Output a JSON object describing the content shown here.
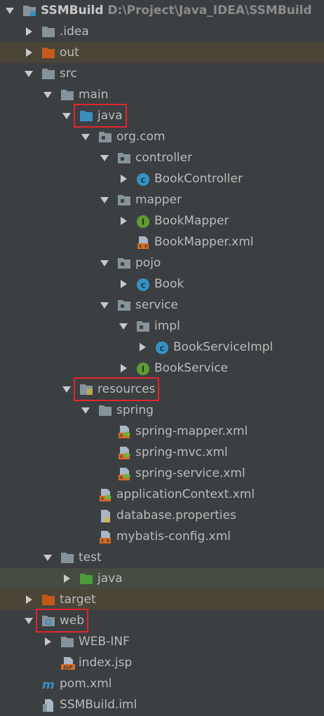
{
  "tree": [
    {
      "label": "SSMBuild",
      "path": "D:\\Project\\Java_IDEA\\SSMBuild",
      "icon": "module-folder-icon",
      "depth": 0,
      "arrow": "down"
    },
    {
      "label": ".idea",
      "icon": "folder-icon",
      "depth": 1,
      "arrow": "right"
    },
    {
      "label": "out",
      "icon": "excluded-folder-icon",
      "depth": 1,
      "arrow": "right",
      "highlight": "brown"
    },
    {
      "label": "src",
      "icon": "folder-icon",
      "depth": 1,
      "arrow": "down"
    },
    {
      "label": "main",
      "icon": "folder-icon",
      "depth": 2,
      "arrow": "down"
    },
    {
      "label": "java",
      "icon": "source-root-folder-icon",
      "depth": 3,
      "arrow": "down",
      "boxed": true
    },
    {
      "label": "org.com",
      "icon": "package-icon",
      "depth": 4,
      "arrow": "down"
    },
    {
      "label": "controller",
      "icon": "package-icon",
      "depth": 5,
      "arrow": "down"
    },
    {
      "label": "BookController",
      "icon": "class-icon",
      "depth": 6,
      "arrow": "right"
    },
    {
      "label": "mapper",
      "icon": "package-icon",
      "depth": 5,
      "arrow": "down"
    },
    {
      "label": "BookMapper",
      "icon": "interface-icon",
      "depth": 6,
      "arrow": "right"
    },
    {
      "label": "BookMapper.xml",
      "icon": "xml-file-icon",
      "depth": 6,
      "arrow": ""
    },
    {
      "label": "pojo",
      "icon": "package-icon",
      "depth": 5,
      "arrow": "down"
    },
    {
      "label": "Book",
      "icon": "class-icon",
      "depth": 6,
      "arrow": "right"
    },
    {
      "label": "service",
      "icon": "package-icon",
      "depth": 5,
      "arrow": "down"
    },
    {
      "label": "impl",
      "icon": "package-icon",
      "depth": 6,
      "arrow": "down"
    },
    {
      "label": "BookServiceImpl",
      "icon": "class-icon",
      "depth": 7,
      "arrow": "right"
    },
    {
      "label": "BookService",
      "icon": "interface-icon",
      "depth": 6,
      "arrow": "right"
    },
    {
      "label": "resources",
      "icon": "resources-root-folder-icon",
      "depth": 3,
      "arrow": "down",
      "boxed": true
    },
    {
      "label": "spring",
      "icon": "folder-icon",
      "depth": 4,
      "arrow": "down"
    },
    {
      "label": "spring-mapper.xml",
      "icon": "spring-xml-icon",
      "depth": 5,
      "arrow": ""
    },
    {
      "label": "spring-mvc.xml",
      "icon": "spring-xml-icon",
      "depth": 5,
      "arrow": ""
    },
    {
      "label": "spring-service.xml",
      "icon": "spring-xml-icon",
      "depth": 5,
      "arrow": ""
    },
    {
      "label": "applicationContext.xml",
      "icon": "spring-xml-icon",
      "depth": 4,
      "arrow": ""
    },
    {
      "label": "database.properties",
      "icon": "properties-file-icon",
      "depth": 4,
      "arrow": ""
    },
    {
      "label": "mybatis-config.xml",
      "icon": "xml-file-icon",
      "depth": 4,
      "arrow": ""
    },
    {
      "label": "test",
      "icon": "folder-icon",
      "depth": 2,
      "arrow": "down"
    },
    {
      "label": "java",
      "icon": "test-source-folder-icon",
      "depth": 3,
      "arrow": "right",
      "highlight": "green"
    },
    {
      "label": "target",
      "icon": "excluded-folder-icon",
      "depth": 1,
      "arrow": "right",
      "highlight": "brown"
    },
    {
      "label": "web",
      "icon": "web-folder-icon",
      "depth": 1,
      "arrow": "down",
      "boxed": true
    },
    {
      "label": "WEB-INF",
      "icon": "folder-icon",
      "depth": 2,
      "arrow": "right"
    },
    {
      "label": "index.jsp",
      "icon": "jsp-file-icon",
      "depth": 2,
      "arrow": ""
    },
    {
      "label": "pom.xml",
      "icon": "maven-icon",
      "depth": 1,
      "arrow": ""
    },
    {
      "label": "SSMBuild.iml",
      "icon": "iml-file-icon",
      "depth": 1,
      "arrow": ""
    }
  ],
  "colors": {
    "background": "#3c3f41",
    "text": "#bbbbbb",
    "folder": "#87939a",
    "source_folder": "#3c8ebf",
    "test_folder": "#4b9b3a",
    "excluded_folder": "#c3591b",
    "class": "#3592c4",
    "interface": "#5f9c35",
    "xml": "#d66b22",
    "highlight_box": "#e0262d"
  }
}
